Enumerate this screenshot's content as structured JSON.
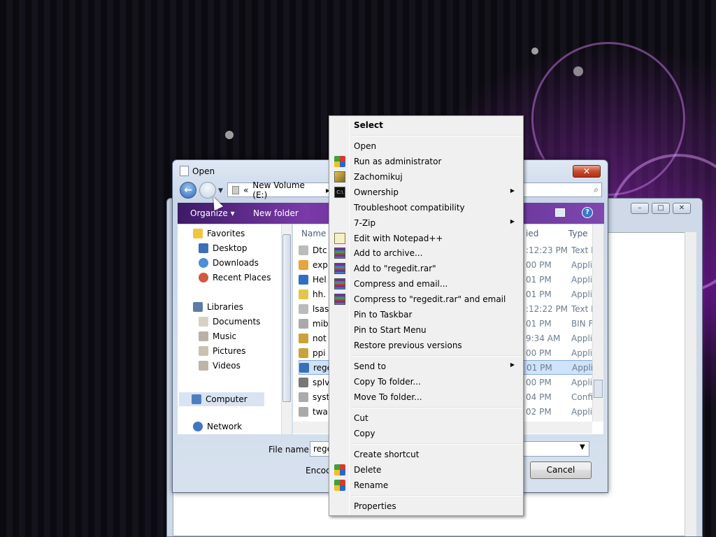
{
  "dialog": {
    "title": "Open",
    "close_glyph": "✕",
    "address": {
      "chevrons": "«",
      "path": "New Volume (E:)",
      "arrow": "▸"
    },
    "search_icon": "search-icon",
    "toolbar": {
      "organize": "Organize ▾",
      "new_folder": "New folder",
      "help": "?"
    },
    "nav": {
      "favorites": "Favorites",
      "desktop": "Desktop",
      "downloads": "Downloads",
      "recent": "Recent Places",
      "libraries": "Libraries",
      "documents": "Documents",
      "music": "Music",
      "pictures": "Pictures",
      "videos": "Videos",
      "computer": "Computer",
      "network": "Network"
    },
    "list": {
      "col_name": "Name",
      "col_date": "ied",
      "col_type": "Type",
      "rows": [
        {
          "name": "Dtc",
          "date": ":12:23 PM",
          "type": "Text D"
        },
        {
          "name": "exp",
          "date": "00 PM",
          "type": "Applic"
        },
        {
          "name": "Hel",
          "date": "01 PM",
          "type": "Applic"
        },
        {
          "name": "hh.",
          "date": "01 PM",
          "type": "Applic"
        },
        {
          "name": "lsas",
          "date": ":12:22 PM",
          "type": "Text D"
        },
        {
          "name": "mib",
          "date": "01 PM",
          "type": "BIN Fil"
        },
        {
          "name": "not",
          "date": "9:34 AM",
          "type": "Applic"
        },
        {
          "name": "ppi",
          "date": "00 PM",
          "type": "Applic"
        },
        {
          "name": "rege",
          "date": "01 PM",
          "type": "Applic"
        },
        {
          "name": "splv",
          "date": "00 PM",
          "type": "Applic"
        },
        {
          "name": "syst",
          "date": "04 PM",
          "type": "Config"
        },
        {
          "name": "twa",
          "date": "02 PM",
          "type": "Applic"
        }
      ]
    },
    "filename_label": "File name:",
    "filename_value": "rege",
    "encoding_label": "Encod",
    "cancel_label": "Cancel"
  },
  "context_menu": {
    "select": "Select",
    "open": "Open",
    "run_admin": "Run as administrator",
    "zachomikuj": "Zachomikuj",
    "ownership": "Ownership",
    "troubleshoot": "Troubleshoot compatibility",
    "sevenzip": "7-Zip",
    "notepadpp": "Edit with Notepad++",
    "add_archive": "Add to archive...",
    "add_regedit": "Add to \"regedit.rar\"",
    "compress_email": "Compress and email...",
    "compress_regedit_email": "Compress to \"regedit.rar\" and email",
    "pin_taskbar": "Pin to Taskbar",
    "pin_start": "Pin to Start Menu",
    "restore": "Restore previous versions",
    "send_to": "Send to",
    "copy_to": "Copy To folder...",
    "move_to": "Move To folder...",
    "cut": "Cut",
    "copy": "Copy",
    "create_shortcut": "Create shortcut",
    "delete": "Delete",
    "rename": "Rename",
    "properties": "Properties",
    "submenu_arrow": "▶"
  },
  "background_window": {
    "min": "–",
    "max": "□",
    "close": "✕"
  }
}
